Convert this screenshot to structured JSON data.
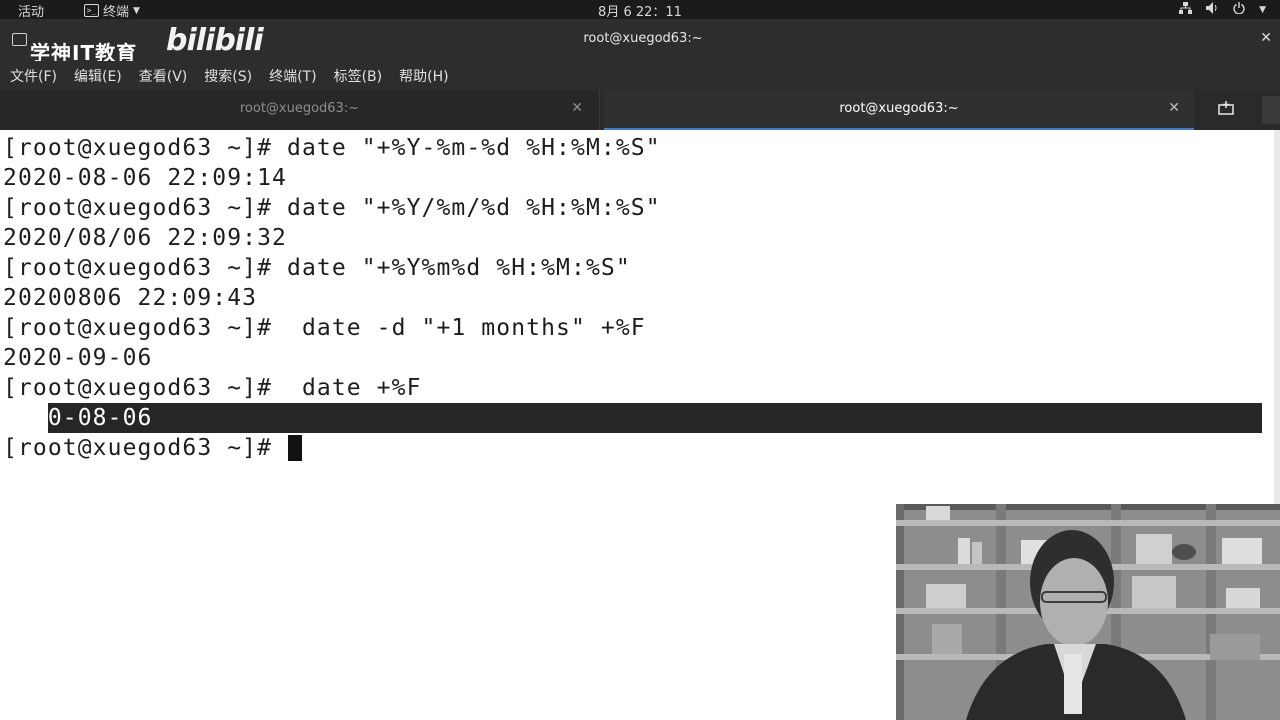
{
  "topbar": {
    "activities": "活动",
    "app_name": "终端",
    "clock": "8月 6 22：11"
  },
  "window": {
    "brand_text": "学神IT教育",
    "watermark_text": "bilibili",
    "title": "root@xuegod63:~"
  },
  "menu": [
    {
      "label": "文件(F)"
    },
    {
      "label": "编辑(E)"
    },
    {
      "label": "查看(V)"
    },
    {
      "label": "搜索(S)"
    },
    {
      "label": "终端(T)"
    },
    {
      "label": "标签(B)"
    },
    {
      "label": "帮助(H)"
    }
  ],
  "tabs": [
    {
      "label": "root@xuegod63:~",
      "active": false
    },
    {
      "label": "root@xuegod63:~",
      "active": true
    }
  ],
  "terminal": {
    "lines": [
      "[root@xuegod63 ~]# date \"+%Y-%m-%d %H:%M:%S\"",
      "2020-08-06 22:09:14",
      "[root@xuegod63 ~]# date \"+%Y/%m/%d %H:%M:%S\"",
      "2020/08/06 22:09:32",
      "[root@xuegod63 ~]# date \"+%Y%m%d %H:%M:%S\"",
      "20200806 22:09:43",
      "[root@xuegod63 ~]#  date -d \"+1 months\" +%F",
      "2020-09-06",
      "[root@xuegod63 ~]#  date +%F",
      "2020-08-06",
      "[root@xuegod63 ~]# "
    ],
    "selected_line_index": 9
  },
  "colors": {
    "terminal_bg": "#ffffff",
    "terminal_fg": "#1e1e1e",
    "selection_bg": "#262626",
    "headerbar": "#2d2d2d",
    "active_tab_accent": "#3a7bd5"
  },
  "icons": {
    "app_menu_icon": "terminal-icon",
    "tray": [
      "network-icon",
      "volume-icon",
      "power-icon"
    ],
    "new_tab": "new-tab-icon",
    "tab_close": "close-icon"
  }
}
